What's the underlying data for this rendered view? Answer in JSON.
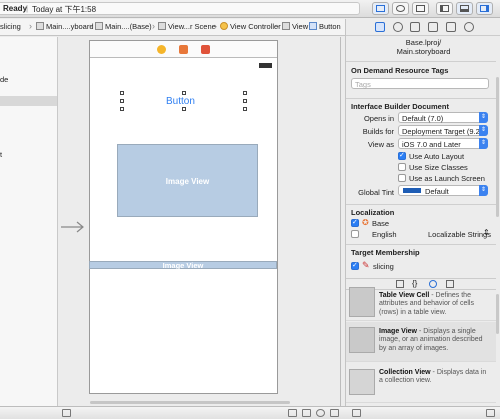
{
  "toolbar": {
    "status": "Ready",
    "separator": "|",
    "time": "Today at 下午1:58"
  },
  "jumpbar": {
    "crumbs": [
      "slicing",
      "Main....yboard",
      "Main....(Base)",
      "View...r Scene",
      "View Controller",
      "View",
      "Button"
    ]
  },
  "outline": {
    "rows": [
      "de",
      "t"
    ]
  },
  "canvas": {
    "button_label": "Button",
    "image_view_label": "Image View",
    "image_view2_label": "Image View"
  },
  "inspector": {
    "file_name": "Base.lproj/",
    "file_name2": "Main.storyboard",
    "on_demand_title": "On Demand Resource Tags",
    "tags_placeholder": "Tags",
    "ib_doc_title": "Interface Builder Document",
    "opens_in_label": "Opens in",
    "opens_in_value": "Default (7.0)",
    "builds_for_label": "Builds for",
    "builds_for_value": "Deployment Target (9.2)",
    "view_as_label": "View as",
    "view_as_value": "iOS 7.0 and Later",
    "use_auto_layout": "Use Auto Layout",
    "use_size_classes": "Use Size Classes",
    "use_launch_screen": "Use as Launch Screen",
    "global_tint_label": "Global Tint",
    "global_tint_value": "Default",
    "localization_title": "Localization",
    "loc_base": "Base",
    "loc_english": "English",
    "loc_english_type": "Localizable Strings",
    "target_membership_title": "Target Membership",
    "target_slicing": "slicing"
  },
  "library": {
    "items": [
      {
        "title": "Table View Cell",
        "desc": " - Defines the attributes and behavior of cells (rows) in a table view."
      },
      {
        "title": "Image View",
        "desc": " - Displays a single image, or an animation described by an array of images."
      },
      {
        "title": "Collection View",
        "desc": " - Displays data in a collection view."
      }
    ]
  },
  "colors": {
    "accent": "#2a7ef5",
    "image_view_fill": "#b7cce3",
    "button_text": "#2f7ff2"
  }
}
